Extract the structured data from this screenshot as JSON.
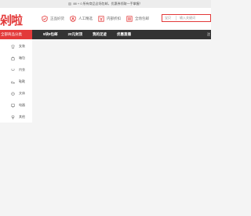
{
  "topbar": {
    "text": "88 + 0  所有商品全场包邮，优惠券领取一手掌握！"
  },
  "logo": {
    "text": "剁啦"
  },
  "features": [
    {
      "icon": "shield-check-icon",
      "label": "正品好货"
    },
    {
      "icon": "person-icon",
      "label": "人工精选"
    },
    {
      "icon": "tag-icon",
      "label": "内部折扣"
    },
    {
      "icon": "shop-icon",
      "label": "全场包邮"
    }
  ],
  "search": {
    "scope": "宝贝",
    "placeholder": "输入关键词"
  },
  "nav": {
    "category_button": "全部商品分类",
    "links": [
      "9块9包邮",
      "20元封顶",
      "我的足迹",
      "优惠直播"
    ],
    "end": "注"
  },
  "sidebar": [
    {
      "icon": "shirt-icon",
      "label": "女装"
    },
    {
      "icon": "bag-icon",
      "label": "箱包"
    },
    {
      "icon": "bra-icon",
      "label": "内衣"
    },
    {
      "icon": "shoe-icon",
      "label": "鞋靴"
    },
    {
      "icon": "food-icon",
      "label": "文体"
    },
    {
      "icon": "monitor-icon",
      "label": "电器"
    },
    {
      "icon": "brush-icon",
      "label": "其他"
    }
  ],
  "colors": {
    "accent": "#e33a3a",
    "navbar": "#333333"
  }
}
